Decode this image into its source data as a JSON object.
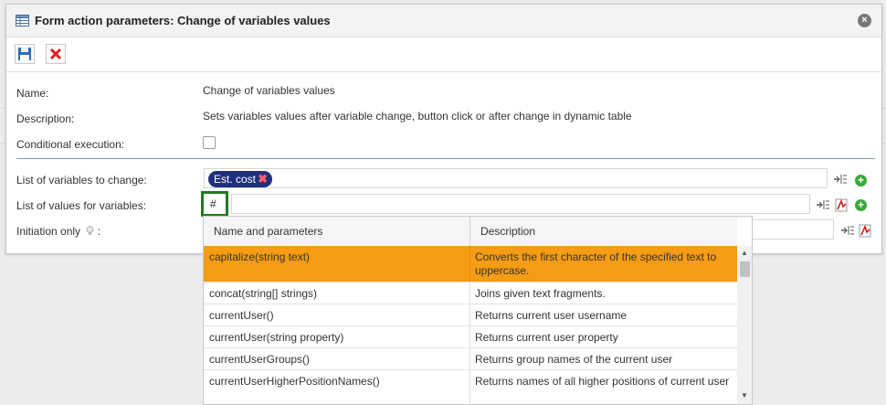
{
  "dialog": {
    "title": "Form action parameters: Change of variables values",
    "close_label": "×"
  },
  "toolbar": {
    "save_icon": "floppy-disk-icon",
    "cancel_icon": "red-x-icon"
  },
  "form": {
    "name_label": "Name:",
    "name_value": "Change of variables values",
    "description_label": "Description:",
    "description_value": "Sets variables values after variable change, button click or after change in dynamic table",
    "conditional_label": "Conditional execution:",
    "conditional_checked": false,
    "variables_label": "List of variables to change:",
    "variable_tag": "Est. cost",
    "variable_tag_remove": "✖",
    "values_label": "List of values for variables:",
    "values_input": "#",
    "initiation_label": "Initiation only",
    "initiation_suffix": ":",
    "plus_symbol": "+"
  },
  "dropdown": {
    "col_name": "Name and parameters",
    "col_desc": "Description",
    "scroll_up": "▲",
    "scroll_down": "▼",
    "rows": [
      {
        "name": "capitalize(string text)",
        "desc": "Converts the first character of the specified text to uppercase.",
        "selected": true
      },
      {
        "name": "concat(string[] strings)",
        "desc": "Joins given text fragments."
      },
      {
        "name": "currentUser()",
        "desc": "Returns current user username"
      },
      {
        "name": "currentUser(string property)",
        "desc": "Returns current user property"
      },
      {
        "name": "currentUserGroups()",
        "desc": "Returns group names of the current user"
      },
      {
        "name": "currentUserHigherPositionNames()",
        "desc": "Returns names of all higher positions of current user"
      }
    ]
  },
  "colors": {
    "selected_row": "#f59c14",
    "tag_bg": "#1f2f7e",
    "active_border": "#1e7d1e",
    "plus_green": "#3aa83a"
  }
}
